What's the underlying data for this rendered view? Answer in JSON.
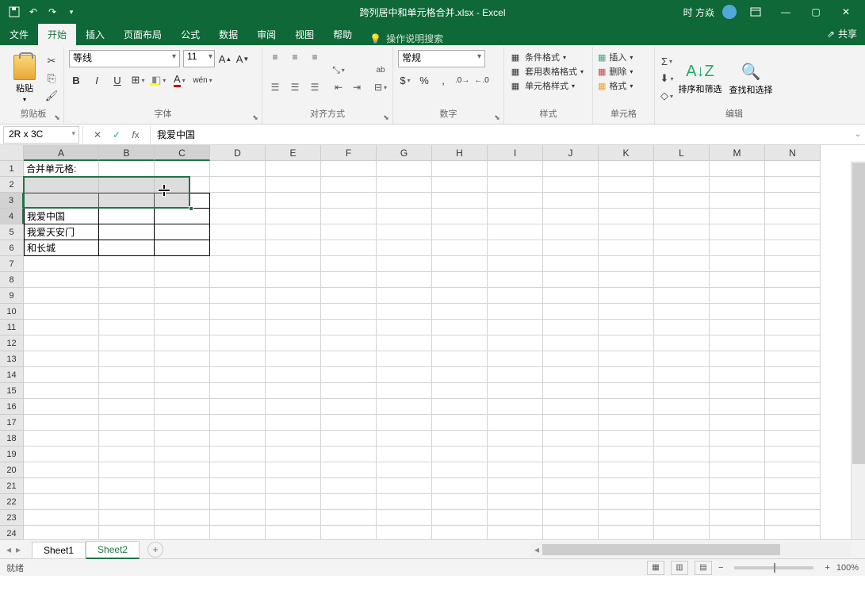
{
  "title": {
    "filename": "跨列居中和单元格合并.xlsx",
    "app": "Excel",
    "user": "时 方焱"
  },
  "tabs": {
    "file": "文件",
    "home": "开始",
    "insert": "插入",
    "layout": "页面布局",
    "formula": "公式",
    "data": "数据",
    "review": "审阅",
    "view": "视图",
    "help": "帮助",
    "tellme": "操作说明搜索"
  },
  "share": "共享",
  "ribbon": {
    "clipboard": {
      "paste": "粘贴",
      "label": "剪贴板"
    },
    "font": {
      "name": "等线",
      "size": "11",
      "label": "字体"
    },
    "align": {
      "wrap": "ab",
      "merge": "合并后居中",
      "label": "对齐方式"
    },
    "number": {
      "format": "常规",
      "label": "数字"
    },
    "styles": {
      "cond": "条件格式",
      "table": "套用表格格式",
      "cell": "单元格样式",
      "label": "样式"
    },
    "cells": {
      "insert": "插入",
      "delete": "删除",
      "format": "格式",
      "label": "单元格"
    },
    "edit": {
      "sort": "排序和筛选",
      "find": "查找和选择",
      "label": "编辑"
    }
  },
  "namebox": "2R x 3C",
  "formula": "我爱中国",
  "cols": [
    "A",
    "B",
    "C",
    "D",
    "E",
    "F",
    "G",
    "H",
    "I",
    "J",
    "K",
    "L",
    "M",
    "N"
  ],
  "rows_visible": 25,
  "cells": {
    "A1": "合并单元格:",
    "A4": "我爱中国",
    "A5": "我爱天安门",
    "A6": "和长城"
  },
  "sheets": {
    "s1": "Sheet1",
    "s2": "Sheet2"
  },
  "status": {
    "ready": "就绪",
    "zoom": "100%"
  }
}
